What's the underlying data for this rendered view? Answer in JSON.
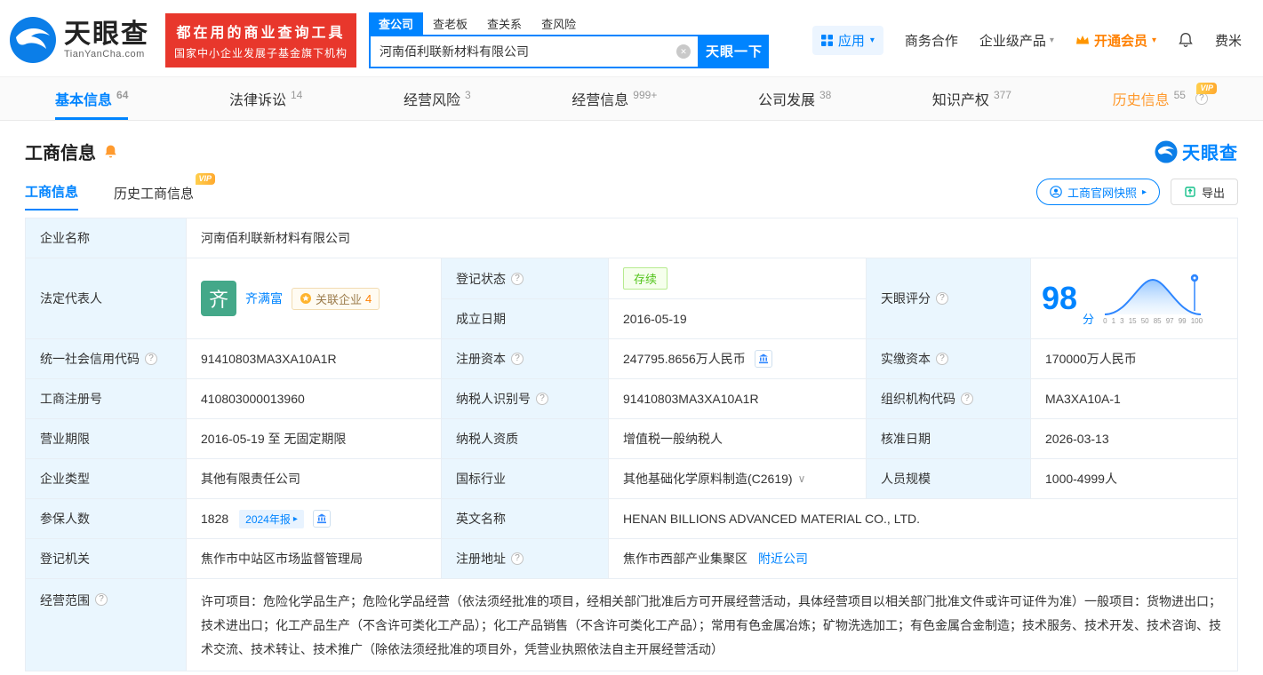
{
  "icons": {
    "help": "?",
    "caret": "▾",
    "chevron": "∨",
    "arrow": "▸",
    "clear": "✕"
  },
  "colors": {
    "primary": "#0084ff",
    "promo_red": "#e8372c",
    "vip_orange": "#ff9a2e",
    "status_green": "#52c41a"
  },
  "header": {
    "brand": "天眼查",
    "brand_domain": "TianYanCha.com",
    "promo_line1": "都在用的商业查询工具",
    "promo_line2": "国家中小企业发展子基金旗下机构",
    "search_tabs": [
      {
        "label": "查公司",
        "active": true
      },
      {
        "label": "查老板",
        "active": false
      },
      {
        "label": "查关系",
        "active": false
      },
      {
        "label": "查风险",
        "active": false
      }
    ],
    "search_value": "河南佰利联新材料有限公司",
    "search_button": "天眼一下",
    "menu_apps": "应用",
    "menu_cooperation": "商务合作",
    "menu_enterprise": "企业级产品",
    "menu_vip": "开通会员",
    "menu_user": "费米"
  },
  "nav_tabs": [
    {
      "label": "基本信息",
      "count": "64"
    },
    {
      "label": "法律诉讼",
      "count": "14"
    },
    {
      "label": "经营风险",
      "count": "3"
    },
    {
      "label": "经营信息",
      "count": "999+"
    },
    {
      "label": "公司发展",
      "count": "38"
    },
    {
      "label": "知识产权",
      "count": "377"
    },
    {
      "label": "历史信息",
      "count": "55"
    }
  ],
  "section": {
    "title": "工商信息",
    "watermark": "天眼查",
    "subtab_current": "工商信息",
    "subtab_history": "历史工商信息",
    "vip_badge": "VIP",
    "snapshot_button": "工商官网快照",
    "export_button": "导出"
  },
  "company": {
    "name_label": "企业名称",
    "name": "河南佰利联新材料有限公司",
    "legal_rep_label": "法定代表人",
    "legal_rep_avatar": "齐",
    "legal_rep_name": "齐满富",
    "related_label": "关联企业",
    "related_count": "4",
    "reg_status_label": "登记状态",
    "reg_status": "存续",
    "establish_label": "成立日期",
    "establish_date": "2016-05-19",
    "score_label": "天眼评分",
    "score": "98",
    "score_unit": "分",
    "score_ticks": [
      "0",
      "1",
      "3",
      "15",
      "50",
      "85",
      "97",
      "99",
      "100"
    ],
    "credit_code_label": "统一社会信用代码",
    "credit_code": "91410803MA3XA10A1R",
    "reg_capital_label": "注册资本",
    "reg_capital": "247795.8656万人民币",
    "paid_capital_label": "实缴资本",
    "paid_capital": "170000万人民币",
    "reg_no_label": "工商注册号",
    "reg_no": "410803000013960",
    "taxpayer_id_label": "纳税人识别号",
    "taxpayer_id": "91410803MA3XA10A1R",
    "org_code_label": "组织机构代码",
    "org_code": "MA3XA10A-1",
    "term_label": "营业期限",
    "term": "2016-05-19 至 无固定期限",
    "taxpayer_quality_label": "纳税人资质",
    "taxpayer_quality": "增值税一般纳税人",
    "approval_label": "核准日期",
    "approval_date": "2026-03-13",
    "type_label": "企业类型",
    "type": "其他有限责任公司",
    "industry_label": "国标行业",
    "industry": "其他基础化学原料制造(C2619)",
    "staff_label": "人员规模",
    "staff": "1000-4999人",
    "insured_label": "参保人数",
    "insured": "1828",
    "annual_report_badge": "2024年报",
    "english_label": "英文名称",
    "english_name": "HENAN BILLIONS ADVANCED MATERIAL CO., LTD.",
    "authority_label": "登记机关",
    "authority": "焦作市中站区市场监督管理局",
    "address_label": "注册地址",
    "address": "焦作市西部产业集聚区",
    "nearby_link": "附近公司",
    "scope_label": "经营范围",
    "scope": "许可项目：危险化学品生产；危险化学品经营（依法须经批准的项目，经相关部门批准后方可开展经营活动，具体经营项目以相关部门批准文件或许可证件为准）一般项目：货物进出口；技术进出口；化工产品生产（不含许可类化工产品）；化工产品销售（不含许可类化工产品）；常用有色金属冶炼；矿物洗选加工；有色金属合金制造；技术服务、技术开发、技术咨询、技术交流、技术转让、技术推广（除依法须经批准的项目外，凭营业执照依法自主开展经营活动）"
  }
}
